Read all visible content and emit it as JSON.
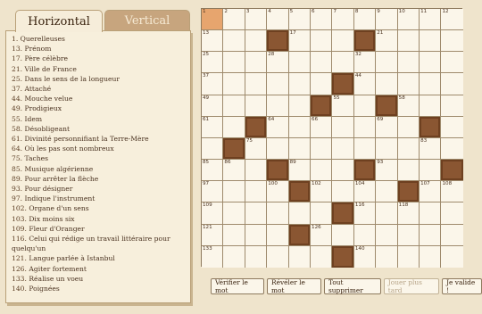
{
  "tabs": {
    "horizontal": "Horizontal",
    "vertical": "Vertical"
  },
  "clues": [
    {
      "num": "1.",
      "text": "Querelleuses"
    },
    {
      "num": "13.",
      "text": "Prénom"
    },
    {
      "num": "17.",
      "text": "Père célèbre"
    },
    {
      "num": "21.",
      "text": "Ville de France"
    },
    {
      "num": "25.",
      "text": "Dans le sens de la longueur"
    },
    {
      "num": "37.",
      "text": "Attaché"
    },
    {
      "num": "44.",
      "text": "Mouche velue"
    },
    {
      "num": "49.",
      "text": "Prodigieux"
    },
    {
      "num": "55.",
      "text": "Idem"
    },
    {
      "num": "58.",
      "text": "Désobligeant"
    },
    {
      "num": "61.",
      "text": "Divinité personnifiant la Terre-Mère"
    },
    {
      "num": "64.",
      "text": "Où les pas sont nombreux"
    },
    {
      "num": "75.",
      "text": "Taches"
    },
    {
      "num": "85.",
      "text": "Musique algérienne"
    },
    {
      "num": "89.",
      "text": "Pour arrêter la flèche"
    },
    {
      "num": "93.",
      "text": "Pour désigner"
    },
    {
      "num": "97.",
      "text": "Indique l'instrument"
    },
    {
      "num": "102.",
      "text": "Organe d'un sens"
    },
    {
      "num": "103.",
      "text": "Dix moins six"
    },
    {
      "num": "109.",
      "text": "Fleur d'Oranger"
    },
    {
      "num": "116.",
      "text": "Celui qui rédige un travail littéraire pour quelqu'un"
    },
    {
      "num": "121.",
      "text": "Langue parlée à Istanbul"
    },
    {
      "num": "126.",
      "text": "Agiter fortement"
    },
    {
      "num": "133.",
      "text": "Réalise un voeu"
    },
    {
      "num": "140.",
      "text": "Poignées"
    }
  ],
  "grid": {
    "rows": [
      [
        {
          "n": "1",
          "selected": true
        },
        {
          "n": "2"
        },
        {
          "n": "3"
        },
        {
          "n": "4"
        },
        {
          "n": "5"
        },
        {
          "n": "6"
        },
        {
          "n": "7"
        },
        {
          "n": "8"
        },
        {
          "n": "9"
        },
        {
          "n": "10"
        },
        {
          "n": "11"
        },
        {
          "n": "12"
        }
      ],
      [
        {
          "n": "13"
        },
        {},
        {},
        {
          "black": true
        },
        {
          "n": "17"
        },
        {},
        {},
        {
          "black": true
        },
        {
          "n": "21"
        },
        {},
        {},
        {}
      ],
      [
        {
          "n": "25"
        },
        {},
        {},
        {
          "n": "28"
        },
        {},
        {},
        {},
        {
          "n": "32"
        },
        {},
        {},
        {},
        {}
      ],
      [
        {
          "n": "37"
        },
        {},
        {},
        {},
        {},
        {},
        {
          "black": true
        },
        {
          "n": "44"
        },
        {},
        {},
        {},
        {}
      ],
      [
        {
          "n": "49"
        },
        {},
        {},
        {},
        {},
        {
          "black": true
        },
        {
          "n": "55"
        },
        {},
        {
          "black": true
        },
        {
          "n": "58"
        },
        {},
        {}
      ],
      [
        {
          "n": "61"
        },
        {},
        {
          "black": true
        },
        {
          "n": "64"
        },
        {},
        {
          "n": "66"
        },
        {},
        {},
        {
          "n": "69"
        },
        {},
        {
          "black": true
        },
        {}
      ],
      [
        {},
        {
          "black": true
        },
        {
          "n": "75"
        },
        {},
        {},
        {},
        {},
        {},
        {},
        {},
        {
          "n": "83"
        },
        {}
      ],
      [
        {
          "n": "85"
        },
        {
          "n": "86"
        },
        {},
        {
          "black": true
        },
        {
          "n": "89"
        },
        {},
        {},
        {
          "black": true
        },
        {
          "n": "93"
        },
        {},
        {},
        {
          "black": true
        }
      ],
      [
        {
          "n": "97"
        },
        {},
        {},
        {
          "n": "100"
        },
        {
          "black": true
        },
        {
          "n": "102"
        },
        {},
        {
          "n": "104"
        },
        {},
        {
          "black": true
        },
        {
          "n": "107"
        },
        {
          "n": "108"
        }
      ],
      [
        {
          "n": "109"
        },
        {},
        {},
        {},
        {},
        {},
        {
          "black": true
        },
        {
          "n": "116"
        },
        {},
        {
          "n": "118"
        },
        {},
        {}
      ],
      [
        {
          "n": "121"
        },
        {},
        {},
        {},
        {
          "black": true
        },
        {
          "n": "126"
        },
        {},
        {},
        {},
        {},
        {},
        {}
      ],
      [
        {
          "n": "133"
        },
        {},
        {},
        {},
        {},
        {},
        {
          "black": true
        },
        {
          "n": "140"
        },
        {},
        {},
        {},
        {}
      ]
    ]
  },
  "buttons": {
    "check_word": "Vérifier le mot",
    "reveal_word": "Révéler le mot",
    "clear_all": "Tout supprimer",
    "play_later": "Jouer plus tard",
    "validate": "Je valide !"
  },
  "colors": {
    "black_cell": "#8a5632",
    "selected_cell": "#e7a56e",
    "panel_bg": "#f7efdc",
    "page_bg": "#efe4cc"
  }
}
